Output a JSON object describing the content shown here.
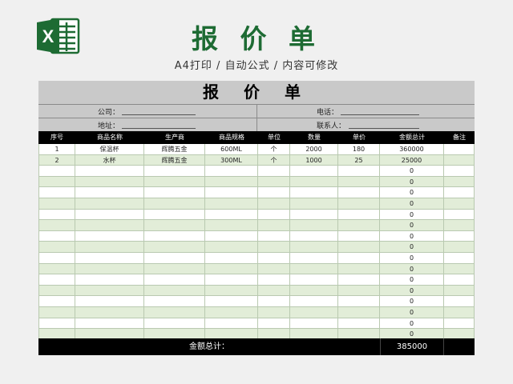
{
  "header": {
    "title": "报 价 单",
    "subtitle": "A4打印 / 自动公式 / 内容可修改",
    "logo_icon": "excel-icon",
    "brand_color": "#1d6b33"
  },
  "sheet": {
    "title": "报 价 单",
    "company_label": "公司：",
    "address_label": "地址：",
    "phone_label": "电话：",
    "contact_label": "联系人：",
    "columns": [
      "序号",
      "商品名称",
      "生产商",
      "商品规格",
      "单位",
      "数量",
      "单价",
      "金额总计",
      "备注"
    ],
    "rows": [
      [
        "1",
        "保温杯",
        "辉腾五金",
        "600ML",
        "个",
        "2000",
        "180",
        "360000",
        ""
      ],
      [
        "2",
        "水杯",
        "辉腾五金",
        "300ML",
        "个",
        "1000",
        "25",
        "25000",
        ""
      ],
      [
        "",
        "",
        "",
        "",
        "",
        "",
        "",
        "0",
        ""
      ],
      [
        "",
        "",
        "",
        "",
        "",
        "",
        "",
        "0",
        ""
      ],
      [
        "",
        "",
        "",
        "",
        "",
        "",
        "",
        "0",
        ""
      ],
      [
        "",
        "",
        "",
        "",
        "",
        "",
        "",
        "0",
        ""
      ],
      [
        "",
        "",
        "",
        "",
        "",
        "",
        "",
        "0",
        ""
      ],
      [
        "",
        "",
        "",
        "",
        "",
        "",
        "",
        "0",
        ""
      ],
      [
        "",
        "",
        "",
        "",
        "",
        "",
        "",
        "0",
        ""
      ],
      [
        "",
        "",
        "",
        "",
        "",
        "",
        "",
        "0",
        ""
      ],
      [
        "",
        "",
        "",
        "",
        "",
        "",
        "",
        "0",
        ""
      ],
      [
        "",
        "",
        "",
        "",
        "",
        "",
        "",
        "0",
        ""
      ],
      [
        "",
        "",
        "",
        "",
        "",
        "",
        "",
        "0",
        ""
      ],
      [
        "",
        "",
        "",
        "",
        "",
        "",
        "",
        "0",
        ""
      ],
      [
        "",
        "",
        "",
        "",
        "",
        "",
        "",
        "0",
        ""
      ],
      [
        "",
        "",
        "",
        "",
        "",
        "",
        "",
        "0",
        ""
      ],
      [
        "",
        "",
        "",
        "",
        "",
        "",
        "",
        "0",
        ""
      ],
      [
        "",
        "",
        "",
        "",
        "",
        "",
        "",
        "0",
        ""
      ]
    ],
    "total_label": "金额总计：",
    "total_value": "385000",
    "row_colors": [
      "#ffffff",
      "#e2edd8"
    ]
  }
}
